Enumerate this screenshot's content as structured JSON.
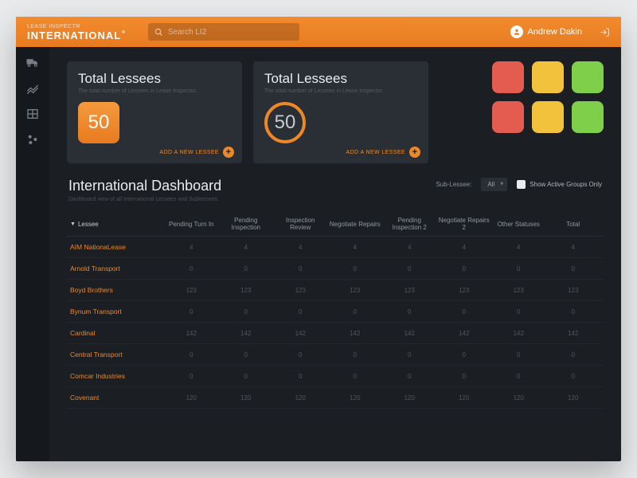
{
  "brand": {
    "small": "LEASE INSPECTR",
    "main": "INTERNATIONAL",
    "tm": "®"
  },
  "search": {
    "placeholder": "Search LI2"
  },
  "user": {
    "name": "Andrew Dakin"
  },
  "sidebar": {
    "items": [
      {
        "name": "truck"
      },
      {
        "name": "chart"
      },
      {
        "name": "table"
      },
      {
        "name": "settings"
      }
    ]
  },
  "cards": [
    {
      "title": "Total Lessees",
      "subtitle": "The total number of Lessees in Lease Inspector.",
      "value": "50",
      "style": "box",
      "action": "ADD A NEW LESSEE"
    },
    {
      "title": "Total Lessees",
      "subtitle": "The total number of Lessees in Lease Inspector.",
      "value": "50",
      "style": "ring",
      "action": "ADD A NEW LESSEE"
    }
  ],
  "tiles": [
    "#e45b50",
    "#f2c23d",
    "#7fcf4a",
    "#e45b50",
    "#f2c23d",
    "#7fcf4a"
  ],
  "dashboard": {
    "title": "International Dashboard",
    "subtitle": "Dashboard view of all International Lessees and Sublessees.",
    "sub_lessee_label": "Sub-Lessee:",
    "sub_lessee_value": "All",
    "show_active_label": "Show Active Groups Only",
    "columns": [
      "Lessee",
      "Pending Turn In",
      "Pending Inspection",
      "Inspection Review",
      "Negotiate Repairs",
      "Pending Inspection 2",
      "Negotiate Repairs 2",
      "Other Statuses",
      "Total"
    ],
    "rows": [
      {
        "name": "AIM NationaLease",
        "cells": [
          "4",
          "4",
          "4",
          "4",
          "4",
          "4",
          "4",
          "4"
        ]
      },
      {
        "name": "Arnold Transport",
        "cells": [
          "0",
          "0",
          "0",
          "0",
          "0",
          "0",
          "0",
          "0"
        ]
      },
      {
        "name": "Boyd Brothers",
        "cells": [
          "123",
          "123",
          "123",
          "123",
          "123",
          "123",
          "123",
          "123"
        ]
      },
      {
        "name": "Bynum Transport",
        "cells": [
          "0",
          "0",
          "0",
          "0",
          "0",
          "0",
          "0",
          "0"
        ]
      },
      {
        "name": "Cardinal",
        "cells": [
          "142",
          "142",
          "142",
          "142",
          "142",
          "142",
          "142",
          "142"
        ]
      },
      {
        "name": "Central Transport",
        "cells": [
          "0",
          "0",
          "0",
          "0",
          "0",
          "0",
          "0",
          "0"
        ]
      },
      {
        "name": "Comcar Industries",
        "cells": [
          "0",
          "0",
          "0",
          "0",
          "0",
          "0",
          "0",
          "0"
        ]
      },
      {
        "name": "Covenant",
        "cells": [
          "120",
          "120",
          "120",
          "120",
          "120",
          "120",
          "120",
          "120"
        ]
      }
    ]
  }
}
